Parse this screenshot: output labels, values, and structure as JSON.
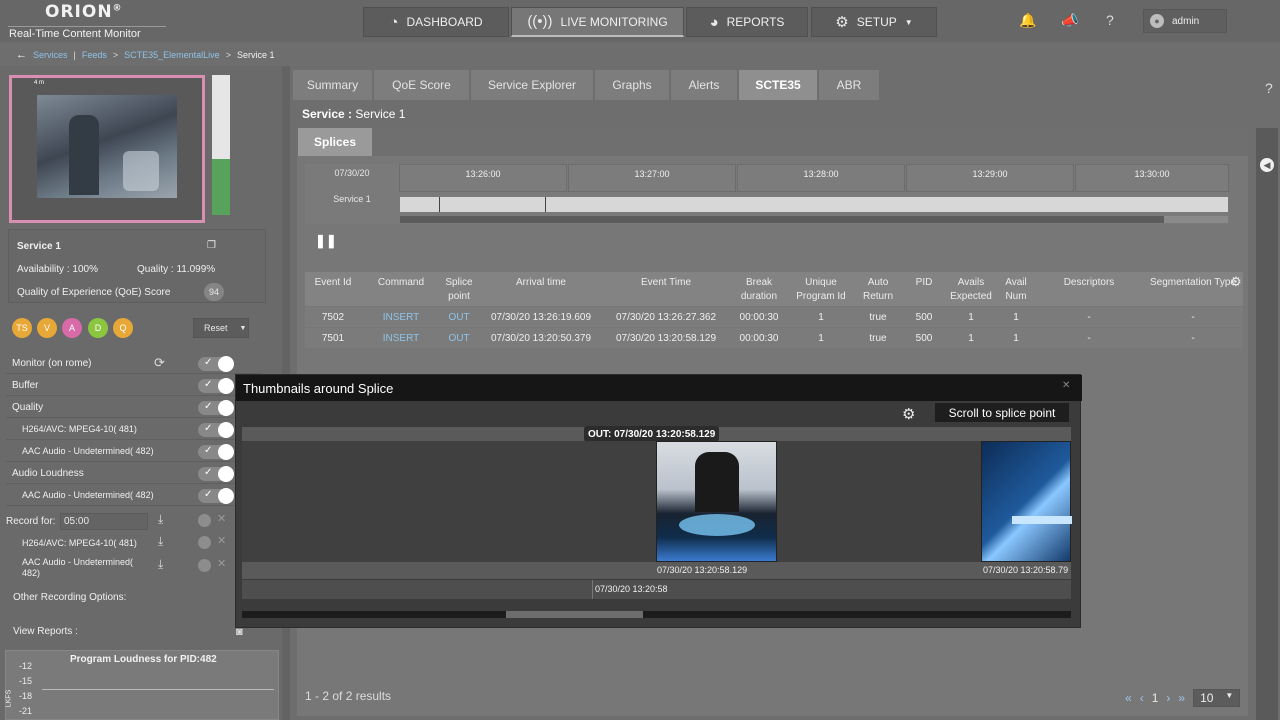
{
  "brand": {
    "name": "ORION",
    "registered": "®",
    "subtitle": "Real-Time Content Monitor"
  },
  "nav": [
    {
      "label": "DASHBOARD",
      "icon": "gauge-icon",
      "active": false
    },
    {
      "label": "LIVE MONITORING",
      "icon": "broadcast-icon",
      "active": true
    },
    {
      "label": "REPORTS",
      "icon": "reports-icon",
      "active": false
    },
    {
      "label": "SETUP",
      "icon": "gear-icon",
      "active": false
    }
  ],
  "user": {
    "name": "admin"
  },
  "breadcrumb": {
    "items": [
      "Services",
      "Feeds",
      "SCTE35_ElementalLive"
    ],
    "current": "Service 1"
  },
  "left": {
    "thumb_caption": "4 m",
    "service_name": "Service 1",
    "availability": "Availability : 100%",
    "quality": "Quality : 11.099%",
    "qoe_label": "Quality of Experience (QoE) Score",
    "qoe_value": "94",
    "badges": [
      {
        "label": "TS",
        "color": "#e8a838"
      },
      {
        "label": "V",
        "color": "#e8a838"
      },
      {
        "label": "A",
        "color": "#d86aa8"
      },
      {
        "label": "D",
        "color": "#8cc63f"
      },
      {
        "label": "Q",
        "color": "#e8a838"
      }
    ],
    "reset_label": "Reset",
    "monitor_rows": [
      "Monitor (on rome)",
      "Buffer",
      "Quality",
      "H264/AVC: MPEG4-10( 481)",
      "AAC Audio - Undetermined( 482)",
      "Audio Loudness",
      "AAC Audio - Undetermined( 482)"
    ],
    "record_for_label": "Record for:",
    "record_for_value": "05:00",
    "record_rows": [
      "H264/AVC: MPEG4-10( 481)",
      "AAC Audio - Undetermined( 482)"
    ],
    "other_recording": "Other Recording Options:",
    "view_reports": "View Reports :",
    "loudness_title": "Program Loudness for PID:482",
    "loudness_ticks": [
      "-12",
      "-15",
      "-18",
      "-21"
    ],
    "loudness_unit": "LKFS"
  },
  "tabs": [
    "Summary",
    "QoE Score",
    "Service Explorer",
    "Graphs",
    "Alerts",
    "SCTE35",
    "ABR"
  ],
  "active_tab": "SCTE35",
  "service_heading": {
    "label": "Service :",
    "value": "Service 1"
  },
  "subtab": "Splices",
  "timeline": {
    "date": "07/30/20",
    "row_label": "Service 1",
    "ticks": [
      "13:26:00",
      "13:27:00",
      "13:28:00",
      "13:29:00",
      "13:30:00"
    ]
  },
  "table": {
    "headers": [
      "Event Id",
      "Command",
      "Splice point",
      "Arrival time",
      "Event Time",
      "Break duration",
      "Unique Program Id",
      "Auto Return",
      "PID",
      "Avails Expected",
      "Avail Num",
      "Descriptors",
      "Segmentation Type"
    ],
    "rows": [
      [
        "7502",
        "INSERT",
        "OUT",
        "07/30/20 13:26:19.609",
        "07/30/20 13:26:27.362",
        "00:00:30",
        "1",
        "true",
        "500",
        "1",
        "1",
        "-",
        "-"
      ],
      [
        "7501",
        "INSERT",
        "OUT",
        "07/30/20 13:20:50.379",
        "07/30/20 13:20:58.129",
        "00:00:30",
        "1",
        "true",
        "500",
        "1",
        "1",
        "-",
        "-"
      ]
    ],
    "results": "1 - 2 of 2 results",
    "page": "1",
    "page_size": "10"
  },
  "modal": {
    "title": "Thumbnails around Splice",
    "scroll_button": "Scroll to splice point",
    "splice_label": "OUT: 07/30/20 13:20:58.129",
    "thumb_times": [
      "07/30/20 13:20:58.129",
      "07/30/20 13:20:58.79"
    ],
    "ruler_label": "07/30/20 13:20:58"
  }
}
